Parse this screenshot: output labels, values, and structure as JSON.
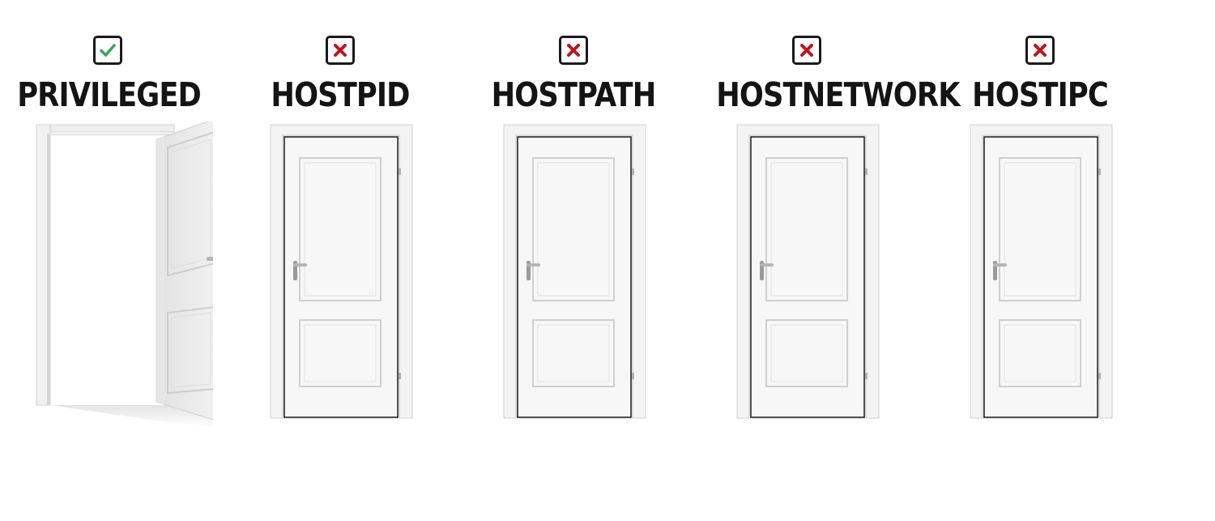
{
  "options": [
    {
      "label": "PRIVILEGED",
      "status": "allowed",
      "door": "open",
      "icon": "check-icon",
      "icon_color": "#3aa655"
    },
    {
      "label": "HOSTPID",
      "status": "denied",
      "door": "closed",
      "icon": "cross-icon",
      "icon_color": "#c0141c"
    },
    {
      "label": "HOSTPATH",
      "status": "denied",
      "door": "closed",
      "icon": "cross-icon",
      "icon_color": "#c0141c"
    },
    {
      "label": "HOSTNETWORK",
      "status": "denied",
      "door": "closed",
      "icon": "cross-icon",
      "icon_color": "#c0141c"
    },
    {
      "label": "HOSTIPC",
      "status": "denied",
      "door": "closed",
      "icon": "cross-icon",
      "icon_color": "#c0141c"
    }
  ]
}
